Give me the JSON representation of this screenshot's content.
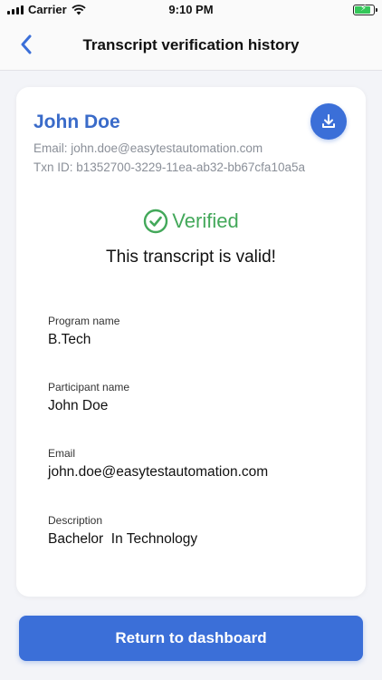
{
  "status_bar": {
    "carrier": "Carrier",
    "time": "9:10 PM",
    "battery_level": 0.9
  },
  "nav": {
    "title": "Transcript verification history",
    "back_icon": "chevron-left-icon"
  },
  "card": {
    "name": "John Doe",
    "email_line": "Email: john.doe@easytestautomation.com",
    "txn_line": "Txn ID: b1352700-3229-11ea-ab32-bb67cfa10a5a",
    "download_icon": "download-icon",
    "verified_label": "Verified",
    "valid_message": "This transcript is valid!",
    "fields": [
      {
        "label": "Program name",
        "value": "B.Tech"
      },
      {
        "label": "Participant name",
        "value": "John Doe"
      },
      {
        "label": "Email",
        "value": "john.doe@easytestautomation.com"
      },
      {
        "label": "Description",
        "value": "Bachelor  In Technology"
      }
    ]
  },
  "actions": {
    "return_label": "Return to dashboard"
  },
  "colors": {
    "accent": "#3b6fd8",
    "name": "#3a6bc9",
    "verified": "#43a85a",
    "meta": "#8a8f98"
  }
}
